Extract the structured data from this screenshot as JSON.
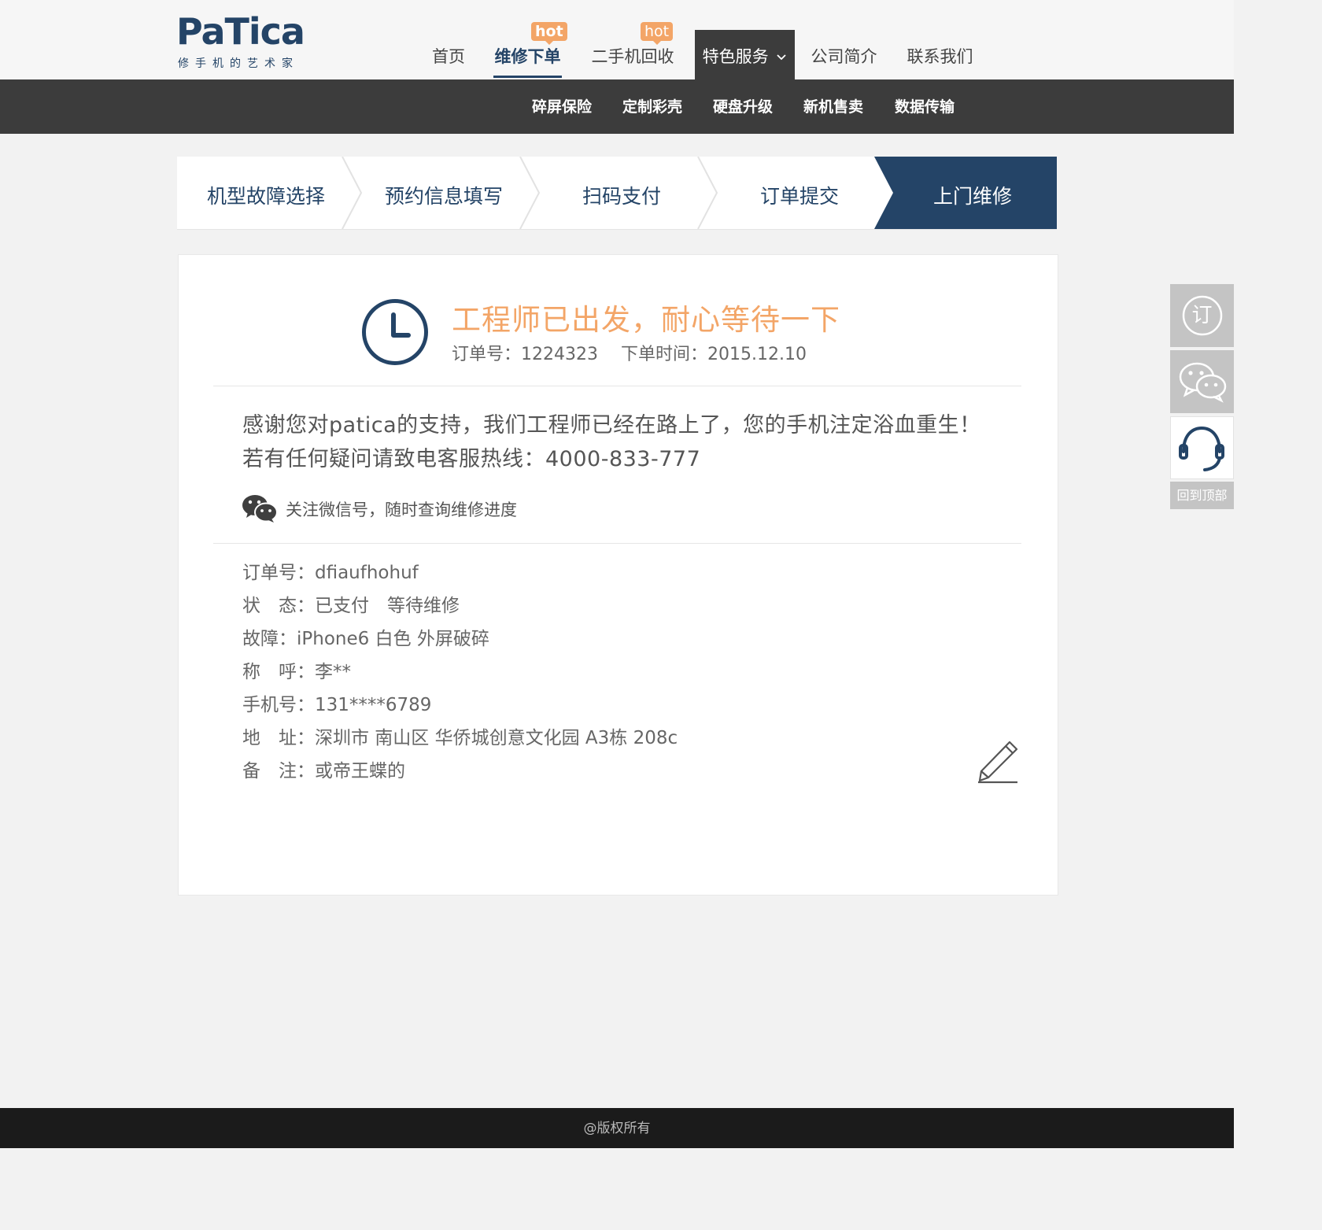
{
  "brand": {
    "name": "PaTica",
    "tagline": "修手机的艺术家",
    "color": "#244467",
    "accent": "#f3a567"
  },
  "nav": {
    "items": [
      {
        "label": "首页"
      },
      {
        "label": "维修下单",
        "badge": "hot",
        "active": true
      },
      {
        "label": "二手机回收",
        "badge": "hot"
      },
      {
        "label": "特色服务",
        "dropdown": true
      },
      {
        "label": "公司简介"
      },
      {
        "label": "联系我们"
      }
    ]
  },
  "subnav": {
    "items": [
      "碎屏保险",
      "定制彩壳",
      "硬盘升级",
      "新机售卖",
      "数据传输"
    ]
  },
  "steps": {
    "items": [
      "机型故障选择",
      "预约信息填写",
      "扫码支付",
      "订单提交",
      "上门维修"
    ],
    "active_index": 4
  },
  "status": {
    "title": "工程师已出发，耐心等待一下",
    "order_no": "订单号：1224323",
    "order_time": "下单时间：2015.12.10"
  },
  "message": {
    "line1": "感谢您对patica的支持，我们工程师已经在路上了，您的手机注定浴血重生！",
    "line2": "若有任何疑问请致电客服热线：4000-833-777"
  },
  "wechat": {
    "text": "关注微信号，随时查询维修进度",
    "icon": "wechat-icon"
  },
  "details": [
    {
      "key": "订单号：",
      "value": "dfiaufhohuf"
    },
    {
      "key": "状　态：",
      "value": "已支付　等待维修"
    },
    {
      "key": "故障：",
      "value": "iPhone6 白色 外屏破碎"
    },
    {
      "key": "称　呼：",
      "value": "李**"
    },
    {
      "key": "手机号：",
      "value": "131****6789"
    },
    {
      "key": "地　址：",
      "value": "深圳市 南山区 华侨城创意文化园 A3栋 208c"
    },
    {
      "key": "备　注：",
      "value": "或帝王蝶的"
    }
  ],
  "sidebar": {
    "order_glyph": "订",
    "back_to_top": "回到顶部",
    "icons": [
      "order-icon",
      "wechat-icon",
      "headset-icon"
    ]
  },
  "footer": {
    "text": "@版权所有"
  }
}
